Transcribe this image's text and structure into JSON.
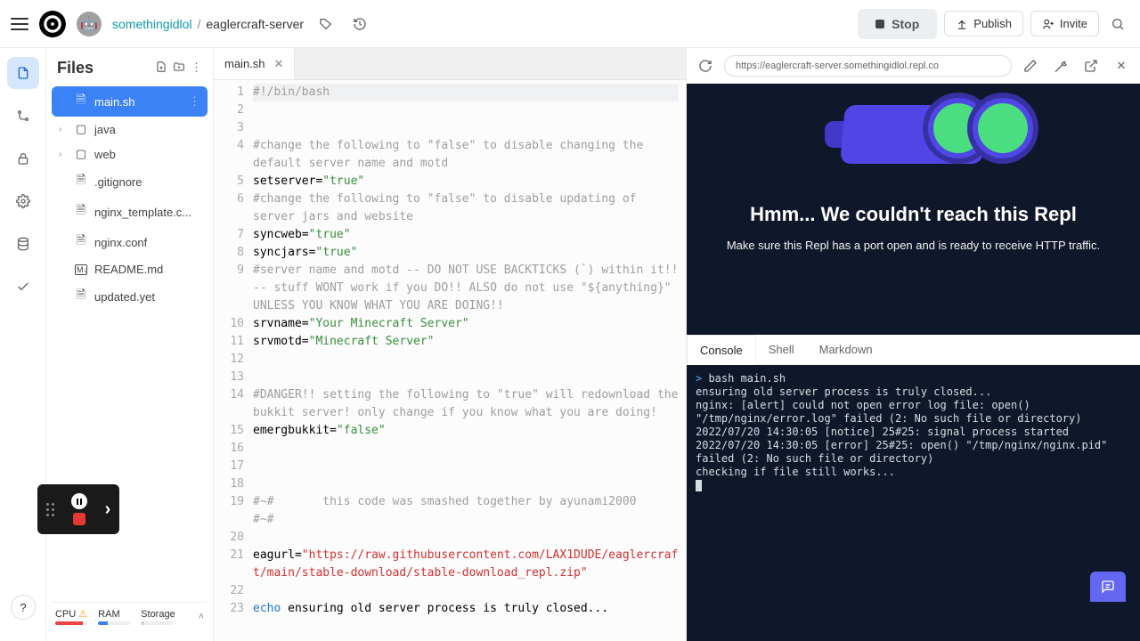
{
  "header": {
    "username": "somethingidlol",
    "repo": "eaglercraft-server",
    "stop_label": "Stop",
    "publish_label": "Publish",
    "invite_label": "Invite"
  },
  "files_panel": {
    "title": "Files",
    "items": [
      {
        "name": "main.sh",
        "type": "file",
        "active": true
      },
      {
        "name": "java",
        "type": "folder"
      },
      {
        "name": "web",
        "type": "folder"
      },
      {
        "name": ".gitignore",
        "type": "file"
      },
      {
        "name": "nginx_template.c...",
        "type": "file"
      },
      {
        "name": "nginx.conf",
        "type": "file"
      },
      {
        "name": "README.md",
        "type": "md"
      },
      {
        "name": "updated.yet",
        "type": "file"
      }
    ]
  },
  "editor": {
    "tab_name": "main.sh",
    "lines": [
      {
        "n": 1,
        "segs": [
          {
            "t": "#!/bin/bash",
            "c": "c-comment"
          }
        ],
        "hl": true
      },
      {
        "n": 2,
        "segs": []
      },
      {
        "n": 3,
        "segs": []
      },
      {
        "n": 4,
        "segs": [
          {
            "t": "#change the following to \"false\" to disable changing the default server name and motd",
            "c": "c-comment"
          }
        ]
      },
      {
        "n": 5,
        "segs": [
          {
            "t": "setserver",
            "c": "c-var"
          },
          {
            "t": "=",
            "c": "c-var"
          },
          {
            "t": "\"true\"",
            "c": "c-str"
          }
        ]
      },
      {
        "n": 6,
        "segs": [
          {
            "t": "#change the following to \"false\" to disable updating of server jars and website",
            "c": "c-comment"
          }
        ]
      },
      {
        "n": 7,
        "segs": [
          {
            "t": "syncweb",
            "c": "c-var"
          },
          {
            "t": "=",
            "c": "c-var"
          },
          {
            "t": "\"true\"",
            "c": "c-str"
          }
        ]
      },
      {
        "n": 8,
        "segs": [
          {
            "t": "syncjars",
            "c": "c-var"
          },
          {
            "t": "=",
            "c": "c-var"
          },
          {
            "t": "\"true\"",
            "c": "c-str"
          }
        ]
      },
      {
        "n": 9,
        "segs": [
          {
            "t": "#server name and motd -- DO NOT USE BACKTICKS (`) within it!! -- stuff WONT work if you DO!! ALSO do not use \"${anything}\" UNLESS YOU KNOW WHAT YOU ARE DOING!!",
            "c": "c-comment"
          }
        ]
      },
      {
        "n": 10,
        "segs": [
          {
            "t": "srvname",
            "c": "c-var"
          },
          {
            "t": "=",
            "c": "c-var"
          },
          {
            "t": "\"Your Minecraft Server\"",
            "c": "c-str"
          }
        ]
      },
      {
        "n": 11,
        "segs": [
          {
            "t": "srvmotd",
            "c": "c-var"
          },
          {
            "t": "=",
            "c": "c-var"
          },
          {
            "t": "\"Minecraft Server\"",
            "c": "c-str"
          }
        ]
      },
      {
        "n": 12,
        "segs": []
      },
      {
        "n": 13,
        "segs": []
      },
      {
        "n": 14,
        "segs": [
          {
            "t": "#DANGER!! setting the following to \"true\" will redownload the bukkit server! only change if you know what you are doing!",
            "c": "c-comment"
          }
        ]
      },
      {
        "n": 15,
        "segs": [
          {
            "t": "emergbukkit",
            "c": "c-var"
          },
          {
            "t": "=",
            "c": "c-var"
          },
          {
            "t": "\"false\"",
            "c": "c-str"
          }
        ]
      },
      {
        "n": 16,
        "segs": []
      },
      {
        "n": 17,
        "segs": []
      },
      {
        "n": 18,
        "segs": []
      },
      {
        "n": 19,
        "segs": [
          {
            "t": "#~#       this code was smashed together by ayunami2000    #~#",
            "c": "c-comment"
          }
        ]
      },
      {
        "n": 20,
        "segs": []
      },
      {
        "n": 21,
        "segs": [
          {
            "t": "eagurl",
            "c": "c-var"
          },
          {
            "t": "=",
            "c": "c-var"
          },
          {
            "t": "\"https://raw.githubusercontent.com/LAX1DUDE/eaglercraft/main/stable-download/stable-download_repl.zip\"",
            "c": "c-str2"
          }
        ]
      },
      {
        "n": 22,
        "segs": []
      },
      {
        "n": 23,
        "segs": [
          {
            "t": "echo ",
            "c": "c-key"
          },
          {
            "t": "ensuring old server process is truly closed...",
            "c": "c-var"
          }
        ]
      }
    ]
  },
  "webview": {
    "url": "https://eaglercraft-server.somethingidlol.repl.co",
    "error_title": "Hmm... We couldn't reach this Repl",
    "error_subtitle": "Make sure this Repl has a port open and is ready to receive HTTP traffic."
  },
  "terminal": {
    "tabs": [
      "Console",
      "Shell",
      "Markdown"
    ],
    "active_tab": 0,
    "lines": [
      "> bash main.sh",
      "ensuring old server process is truly closed...",
      "nginx: [alert] could not open error log file: open() \"/tmp/nginx/error.log\" failed (2: No such file or directory)",
      "2022/07/20 14:30:05 [notice] 25#25: signal process started",
      "2022/07/20 14:30:05 [error] 25#25: open() \"/tmp/nginx/nginx.pid\" failed (2: No such file or directory)",
      "checking if file still works..."
    ]
  },
  "status": {
    "cpu_label": "CPU",
    "ram_label": "RAM",
    "storage_label": "Storage",
    "cpu_pct": 85,
    "ram_pct": 30,
    "storage_pct": 10,
    "cpu_color": "#ef4444",
    "ram_color": "#3b82f6",
    "storage_color": "#cbd5e1"
  }
}
